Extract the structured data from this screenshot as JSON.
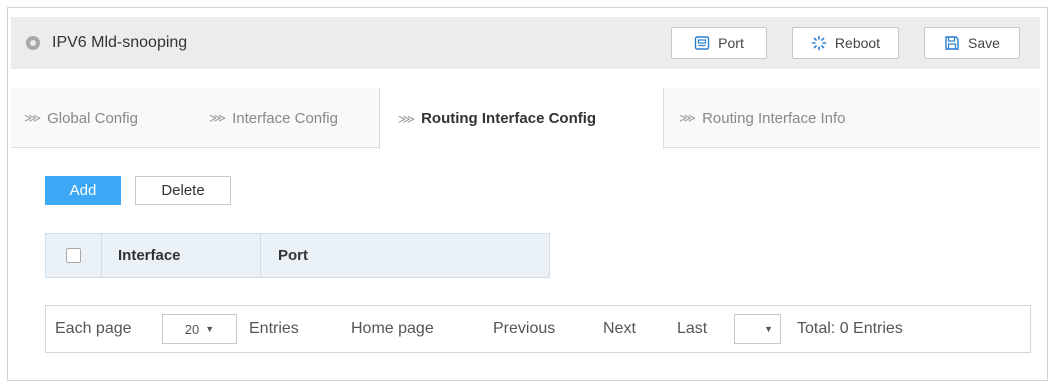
{
  "header": {
    "title": "IPV6 Mld-snooping",
    "port_label": "Port",
    "reboot_label": "Reboot",
    "save_label": "Save"
  },
  "tabs": [
    {
      "label": "Global Config",
      "active": false
    },
    {
      "label": "Interface Config",
      "active": false
    },
    {
      "label": "Routing Interface Config",
      "active": true
    },
    {
      "label": "Routing Interface Info",
      "active": false
    }
  ],
  "actions": {
    "add_label": "Add",
    "delete_label": "Delete"
  },
  "table": {
    "columns": [
      "Interface",
      "Port"
    ],
    "rows": []
  },
  "pager": {
    "each_page_label": "Each page",
    "page_size": "20",
    "entries_label": "Entries",
    "home_label": "Home page",
    "previous_label": "Previous",
    "next_label": "Next",
    "last_label": "Last",
    "jump_value": "",
    "total_label": "Total: 0 Entries"
  },
  "colors": {
    "accent": "#3da8f5",
    "header_bg": "#ececec",
    "table_head_bg": "#eaf2f8"
  }
}
